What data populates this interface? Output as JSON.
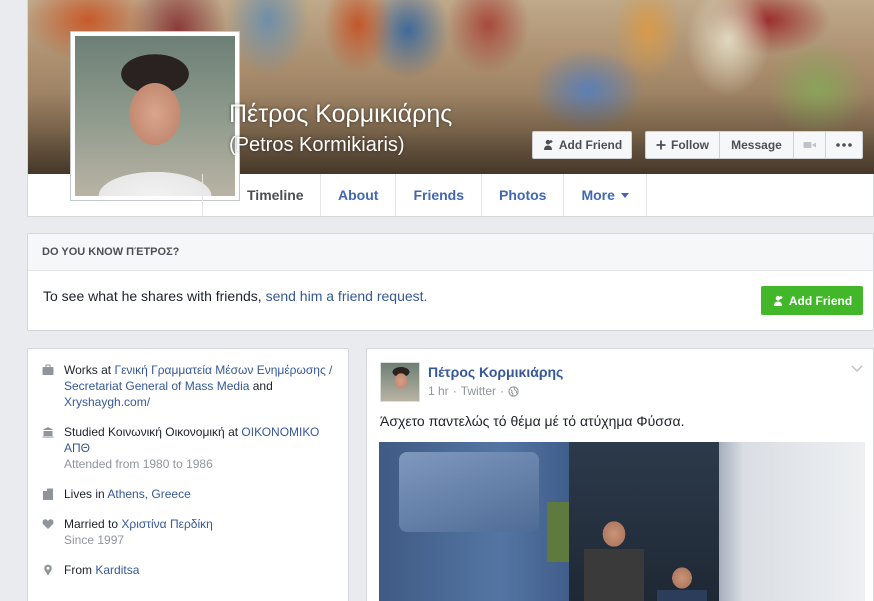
{
  "profile": {
    "name": "Πέτρος Κορμικιάρης",
    "alternate_name": "(Petros Kormikiaris)"
  },
  "actions": {
    "add_friend": "Add Friend",
    "follow": "Follow",
    "message": "Message"
  },
  "tabs": [
    {
      "label": "Timeline",
      "active": true
    },
    {
      "label": "About"
    },
    {
      "label": "Friends"
    },
    {
      "label": "Photos"
    },
    {
      "label": "More"
    }
  ],
  "know_box": {
    "heading": "DO YOU KNOW ΠΈΤΡΟΣ?",
    "text_prefix": "To see what he shares with friends, ",
    "link": "send him a friend request.",
    "button": "Add Friend"
  },
  "intro": {
    "work": {
      "prefix": "Works at ",
      "employer": "Γενική Γραμματεία Μέσων Ενημέρωσης / Secretariat General of Mass Media",
      "and": " and ",
      "employer2": "Xryshaygh.com/"
    },
    "education": {
      "prefix": "Studied Κοινωνική Οικονομική at ",
      "school": "ΟΙΚΟΝΟΜΙΚΟ ΑΠΘ",
      "attended": "Attended from 1980 to 1986"
    },
    "lives": {
      "prefix": "Lives in ",
      "place": "Athens, Greece"
    },
    "married": {
      "prefix": "Married to ",
      "spouse": "Χριστίνα Περδίκη",
      "since": "Since 1997"
    },
    "from": {
      "prefix": "From ",
      "place": "Karditsa"
    }
  },
  "post": {
    "author": "Πέτρος Κορμικιάρης",
    "time": "1 hr",
    "separator": "·",
    "source": "Twitter",
    "text": "Άσχετο παντελώς τό θέμα μέ τό ατύχημα Φύσσα."
  },
  "colors": {
    "link": "#365899",
    "tab_link": "#4267b2",
    "green": "#42b72a",
    "page_bg": "#e9ebee"
  }
}
